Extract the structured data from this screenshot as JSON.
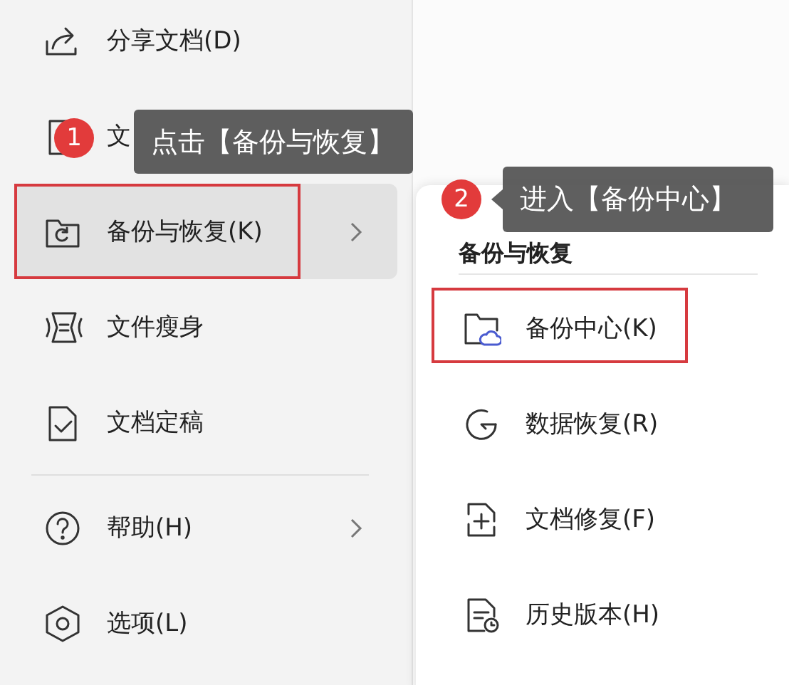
{
  "menu": {
    "items": [
      {
        "kind": "item",
        "label": "分享文档(D)",
        "selected": false
      },
      {
        "kind": "item",
        "label": "文",
        "selected": false
      },
      {
        "kind": "item",
        "label": "备份与恢复(K)",
        "has_submenu": true,
        "selected": true,
        "outlined": true
      },
      {
        "kind": "item",
        "label": "文件瘦身",
        "selected": false
      },
      {
        "kind": "item",
        "label": "文档定稿",
        "selected": false
      },
      {
        "kind": "divider"
      },
      {
        "kind": "item",
        "label": "帮助(H)",
        "has_submenu": true,
        "selected": false
      },
      {
        "kind": "item",
        "label": "选项(L)",
        "selected": false
      }
    ]
  },
  "submenu": {
    "title": "备份与恢复",
    "items": [
      {
        "label": "备份中心(K)",
        "outlined": true
      },
      {
        "label": "数据恢复(R)"
      },
      {
        "label": "文档修复(F)"
      },
      {
        "label": "历史版本(H)"
      }
    ]
  },
  "callouts": [
    {
      "number": "1",
      "text": "点击【备份与恢复】"
    },
    {
      "number": "2",
      "text": "进入【备份中心】"
    }
  ]
}
